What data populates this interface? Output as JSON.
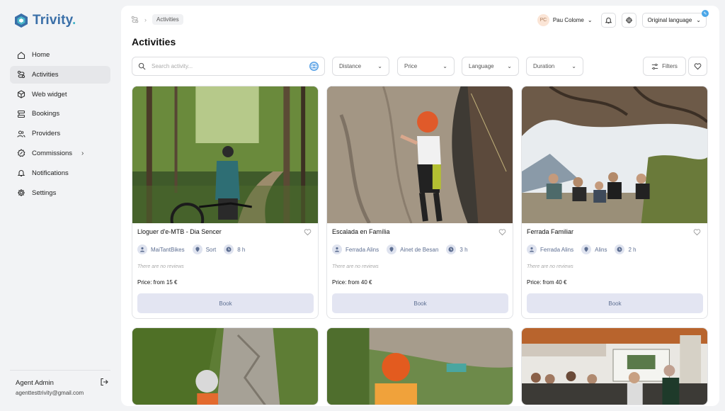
{
  "app": {
    "logo_text": "Trivity",
    "logo_dot": "."
  },
  "sidebar": {
    "items": [
      {
        "label": "Home",
        "icon": "home-icon"
      },
      {
        "label": "Activities",
        "icon": "route-icon",
        "active": true
      },
      {
        "label": "Web widget",
        "icon": "cube-icon"
      },
      {
        "label": "Bookings",
        "icon": "stack-icon"
      },
      {
        "label": "Providers",
        "icon": "users-icon"
      },
      {
        "label": "Commissions",
        "icon": "percent-icon",
        "chevron": "›"
      },
      {
        "label": "Notifications",
        "icon": "bell-icon"
      },
      {
        "label": "Settings",
        "icon": "gear-icon"
      }
    ]
  },
  "user": {
    "name": "Agent Admin",
    "email": "agenttesttrivity@gmail.com"
  },
  "header": {
    "breadcrumb": "Activities",
    "profile_initials": "PC",
    "profile_name": "Pau Colome",
    "language": "Original language",
    "language_badge": "✎"
  },
  "page": {
    "title": "Activities"
  },
  "search": {
    "placeholder": "Search activity..."
  },
  "filters": [
    {
      "label": "Distance"
    },
    {
      "label": "Price"
    },
    {
      "label": "Language"
    },
    {
      "label": "Duration"
    }
  ],
  "filters_button": "Filters",
  "cards": [
    {
      "title": "Lloguer d'e-MTB - Dia Sencer",
      "provider": "MaiTantBikes",
      "location": "Sort",
      "duration": "8 h",
      "reviews": "There are no reviews",
      "price": "Price: from 15 €",
      "cta": "Book"
    },
    {
      "title": "Escalada en Família",
      "provider": "Ferrada Alins",
      "location": "Ainet de Besan",
      "duration": "3 h",
      "reviews": "There are no reviews",
      "price": "Price: from 40 €",
      "cta": "Book"
    },
    {
      "title": "Ferrada Familiar",
      "provider": "Ferrada Alins",
      "location": "Alins",
      "duration": "2 h",
      "reviews": "There are no reviews",
      "price": "Price: from 40 €",
      "cta": "Book"
    }
  ],
  "colors": {
    "brand": "#3a6fa8",
    "accent": "#49b6c9",
    "book_bg": "#e3e5f2",
    "meta_text": "#5e6f92"
  }
}
